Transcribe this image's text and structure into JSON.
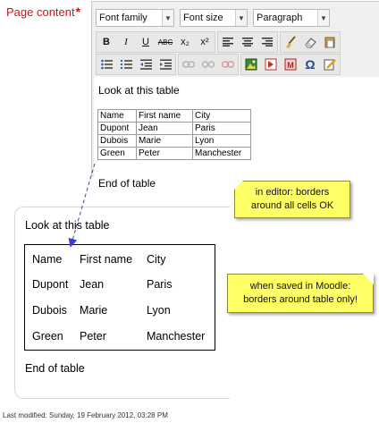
{
  "form": {
    "label": "Page content",
    "required_mark": "*"
  },
  "toolbar": {
    "font_family": "Font family",
    "font_size": "Font size",
    "paragraph": "Paragraph",
    "bold": "B",
    "italic": "I",
    "underline": "U",
    "strike": "ABC",
    "subscript": "x₂",
    "superscript": "x²",
    "omega": "Ω"
  },
  "editor": {
    "intro": "Look at this table",
    "outro": "End of table",
    "table": {
      "headers": [
        "Name",
        "First name",
        "City"
      ],
      "rows": [
        [
          "Dupont",
          "Jean",
          "Paris"
        ],
        [
          "Dubois",
          "Marie",
          "Lyon"
        ],
        [
          "Green",
          "Peter",
          "Manchester"
        ]
      ]
    }
  },
  "saved_view": {
    "intro": "Look at this table",
    "outro": "End of table",
    "table": {
      "headers": [
        "Name",
        "First name",
        "City"
      ],
      "rows": [
        [
          "Dupont",
          "Jean",
          "Paris"
        ],
        [
          "Dubois",
          "Marie",
          "Lyon"
        ],
        [
          "Green",
          "Peter",
          "Manchester"
        ]
      ]
    }
  },
  "notes": {
    "editor_note_line1": "in editor: borders",
    "editor_note_line2": "around all cells OK",
    "saved_note_line1": "when saved in Moodle:",
    "saved_note_line2": "borders around table only!"
  },
  "footer": {
    "last_modified": "Last modified: Sunday, 19 February 2012, 03:28 PM"
  },
  "colors": {
    "label_red": "#c8161d",
    "note_yellow": "#ffff66",
    "arrow_blue": "#3a3ae0"
  }
}
